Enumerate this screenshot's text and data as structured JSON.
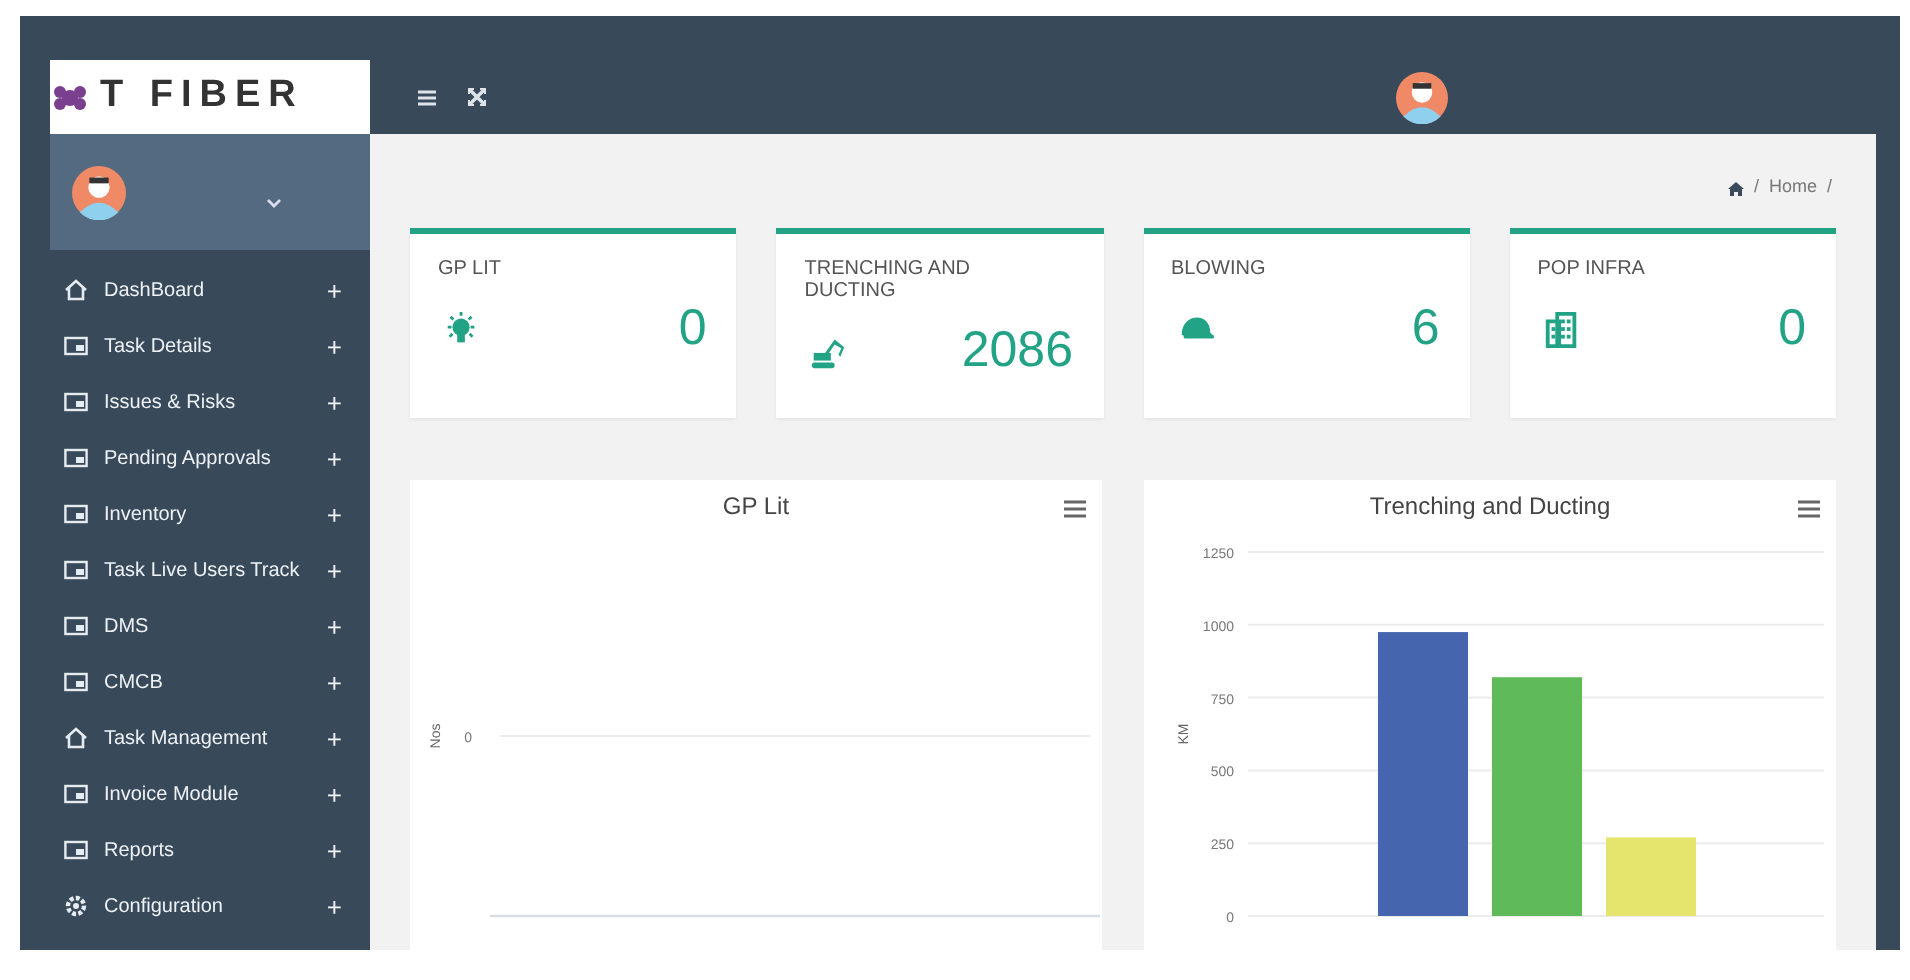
{
  "logo": {
    "text": "T FIBER"
  },
  "sidebar": {
    "items": [
      {
        "label": "DashBoard",
        "kind": "home",
        "expander": "+"
      },
      {
        "label": "Task Details",
        "kind": "module",
        "expander": "+"
      },
      {
        "label": "Issues & Risks",
        "kind": "module",
        "expander": "+"
      },
      {
        "label": "Pending Approvals",
        "kind": "module",
        "expander": "+"
      },
      {
        "label": "Inventory",
        "kind": "module",
        "expander": "+"
      },
      {
        "label": "Task Live Users Track",
        "kind": "module",
        "expander": "+"
      },
      {
        "label": "DMS",
        "kind": "module",
        "expander": "+"
      },
      {
        "label": "CMCB",
        "kind": "module",
        "expander": "+"
      },
      {
        "label": "Task Management",
        "kind": "home",
        "expander": "+"
      },
      {
        "label": "Invoice Module",
        "kind": "module",
        "expander": "+"
      },
      {
        "label": "Reports",
        "kind": "module",
        "expander": "+"
      },
      {
        "label": "Configuration",
        "kind": "settings",
        "expander": "+"
      }
    ]
  },
  "breadcrumb": [
    {
      "kind": "home"
    },
    {
      "kind": "separator",
      "text": "/"
    },
    {
      "kind": "link",
      "text": "Home"
    },
    {
      "kind": "separator",
      "text": "/"
    }
  ],
  "stats": [
    {
      "title": "GP LIT",
      "value": "0",
      "kind": "bulb"
    },
    {
      "title": "TRENCHING AND DUCTING",
      "value": "2086",
      "kind": "excavator"
    },
    {
      "title": "BLOWING",
      "value": "6",
      "kind": "helmet"
    },
    {
      "title": "POP INFRA",
      "value": "0",
      "kind": "building"
    }
  ],
  "charts": [
    {
      "kind": "empty",
      "title": "GP Lit",
      "ylabel": "Nos",
      "ytick": "0"
    },
    {
      "kind": "chart",
      "chart_data": {
        "type": "bar",
        "title": "Trenching and Ducting",
        "ylabel": "KM",
        "ylim": [
          0,
          1250
        ],
        "yticks": [
          0,
          250,
          500,
          750,
          1000,
          1250
        ],
        "grid": true,
        "series": [
          {
            "color": "#4565ae",
            "values": [
              975
            ]
          },
          {
            "color": "#5fbb5a",
            "values": [
              820
            ]
          },
          {
            "color": "#e5e56e",
            "values": [
              270
            ]
          }
        ]
      }
    }
  ]
}
